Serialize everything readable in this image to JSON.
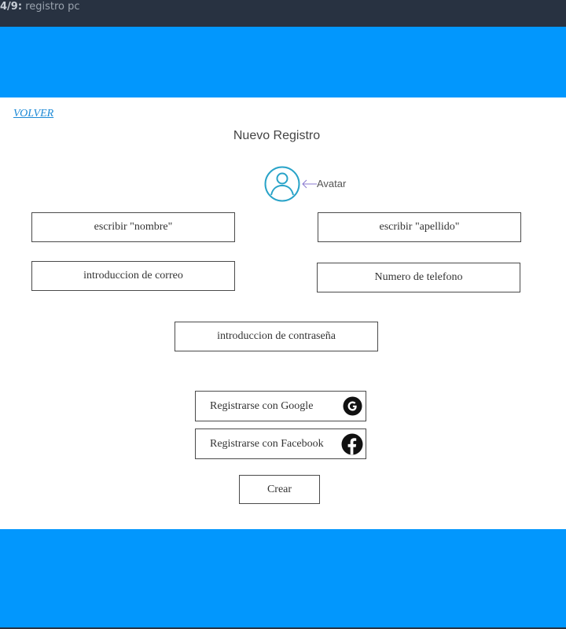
{
  "topbar": {
    "index": "4/9:",
    "title": "registro pc"
  },
  "nav": {
    "back": "VOLVER"
  },
  "page": {
    "title": "Nuevo Registro"
  },
  "avatar": {
    "label": "Avatar"
  },
  "form": {
    "first_name": "escribir \"nombre\"",
    "last_name": "escribir \"apellido\"",
    "email": "introduccion de correo",
    "phone": "Numero de telefono",
    "password": "introduccion de contraseña"
  },
  "social": {
    "google": "Registrarse con Google",
    "facebook": "Registrarse con Facebook"
  },
  "actions": {
    "create": "Crear"
  },
  "colors": {
    "band": "#0297fd",
    "topbar": "#283241",
    "avatar": "#29a3c8",
    "link": "#1a88d6"
  }
}
